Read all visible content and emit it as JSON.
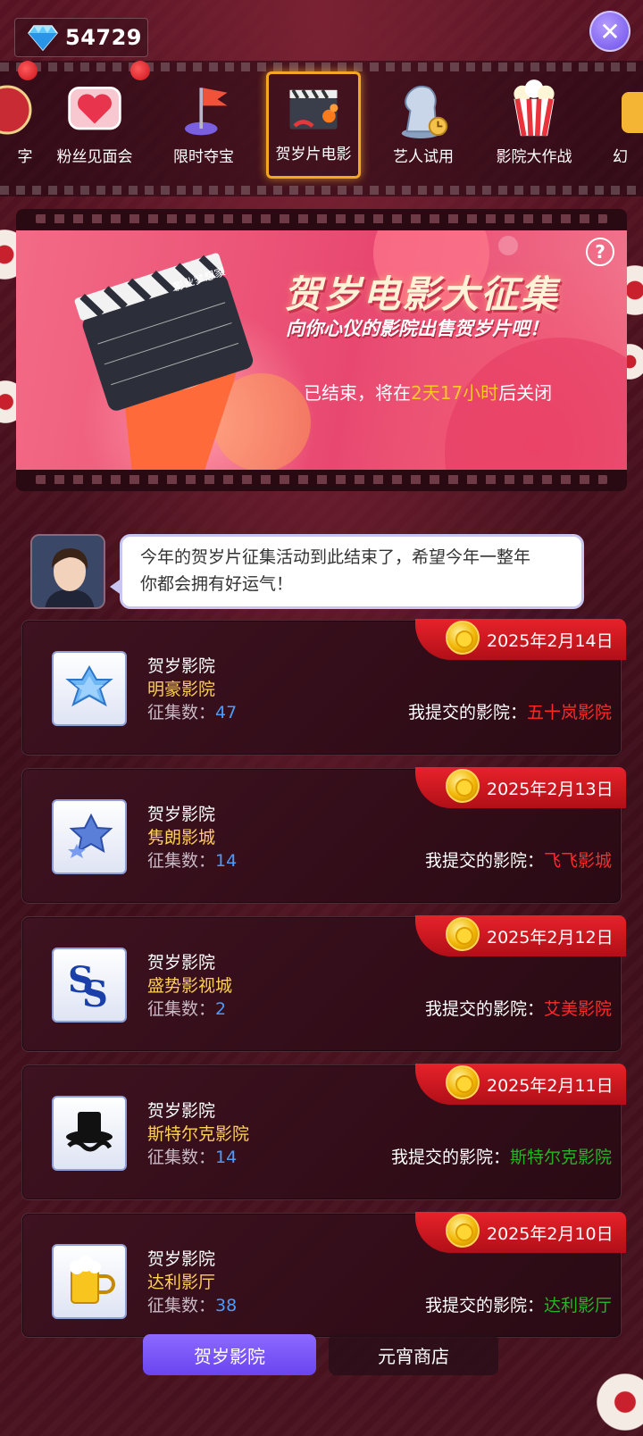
{
  "header": {
    "gem_count": "54729",
    "close_symbol": "✕"
  },
  "categories": [
    {
      "label": "字",
      "icon": "partial-icon"
    },
    {
      "label": "粉丝见面会",
      "icon": "heart-icon"
    },
    {
      "label": "限时夺宝",
      "icon": "flag-icon"
    },
    {
      "label": "贺岁片电影",
      "icon": "clapperboard-icon",
      "active": true
    },
    {
      "label": "艺人试用",
      "icon": "chess-knight-icon"
    },
    {
      "label": "影院大作战",
      "icon": "popcorn-icon"
    },
    {
      "label": "幻",
      "icon": "partial-icon"
    }
  ],
  "banner": {
    "title": "贺岁电影大征集",
    "subtitle": "向你心仪的影院出售贺岁片吧！",
    "status_prefix": "已结束，将在",
    "status_highlight": "2天17小时",
    "status_suffix": "后关闭",
    "help_symbol": "?",
    "clapper_text": "影业梦想家"
  },
  "dialog": {
    "line1": "今年的贺岁片征集活动到此结束了，希望今年一整年",
    "line2": "你都会拥有好运气！"
  },
  "cards": [
    {
      "date": "2025年2月14日",
      "type": "贺岁影院",
      "name": "明豪影院",
      "count_label": "征集数：",
      "count": "47",
      "submit_label": "我提交的影院：",
      "submitted": "五十岚影院",
      "submitted_color": "red"
    },
    {
      "date": "2025年2月13日",
      "type": "贺岁影院",
      "name": "隽朗影城",
      "count_label": "征集数：",
      "count": "14",
      "submit_label": "我提交的影院：",
      "submitted": "飞飞影城",
      "submitted_color": "red"
    },
    {
      "date": "2025年2月12日",
      "type": "贺岁影院",
      "name": "盛势影视城",
      "count_label": "征集数：",
      "count": "2",
      "submit_label": "我提交的影院：",
      "submitted": "艾美影院",
      "submitted_color": "red"
    },
    {
      "date": "2025年2月11日",
      "type": "贺岁影院",
      "name": "斯特尔克影院",
      "count_label": "征集数：",
      "count": "14",
      "submit_label": "我提交的影院：",
      "submitted": "斯特尔克影院",
      "submitted_color": "green"
    },
    {
      "date": "2025年2月10日",
      "type": "贺岁影院",
      "name": "达利影厅",
      "count_label": "征集数：",
      "count": "38",
      "submit_label": "我提交的影院：",
      "submitted": "达利影厅",
      "submitted_color": "green"
    }
  ],
  "tabs": {
    "active": "贺岁影院",
    "inactive": "元宵商店"
  },
  "colors": {
    "accent_purple": "#7a56f5",
    "highlight_yellow": "#ffc628",
    "submit_red": "#ff2a2a",
    "submit_green": "#27b327",
    "count_blue": "#4a9cff"
  }
}
